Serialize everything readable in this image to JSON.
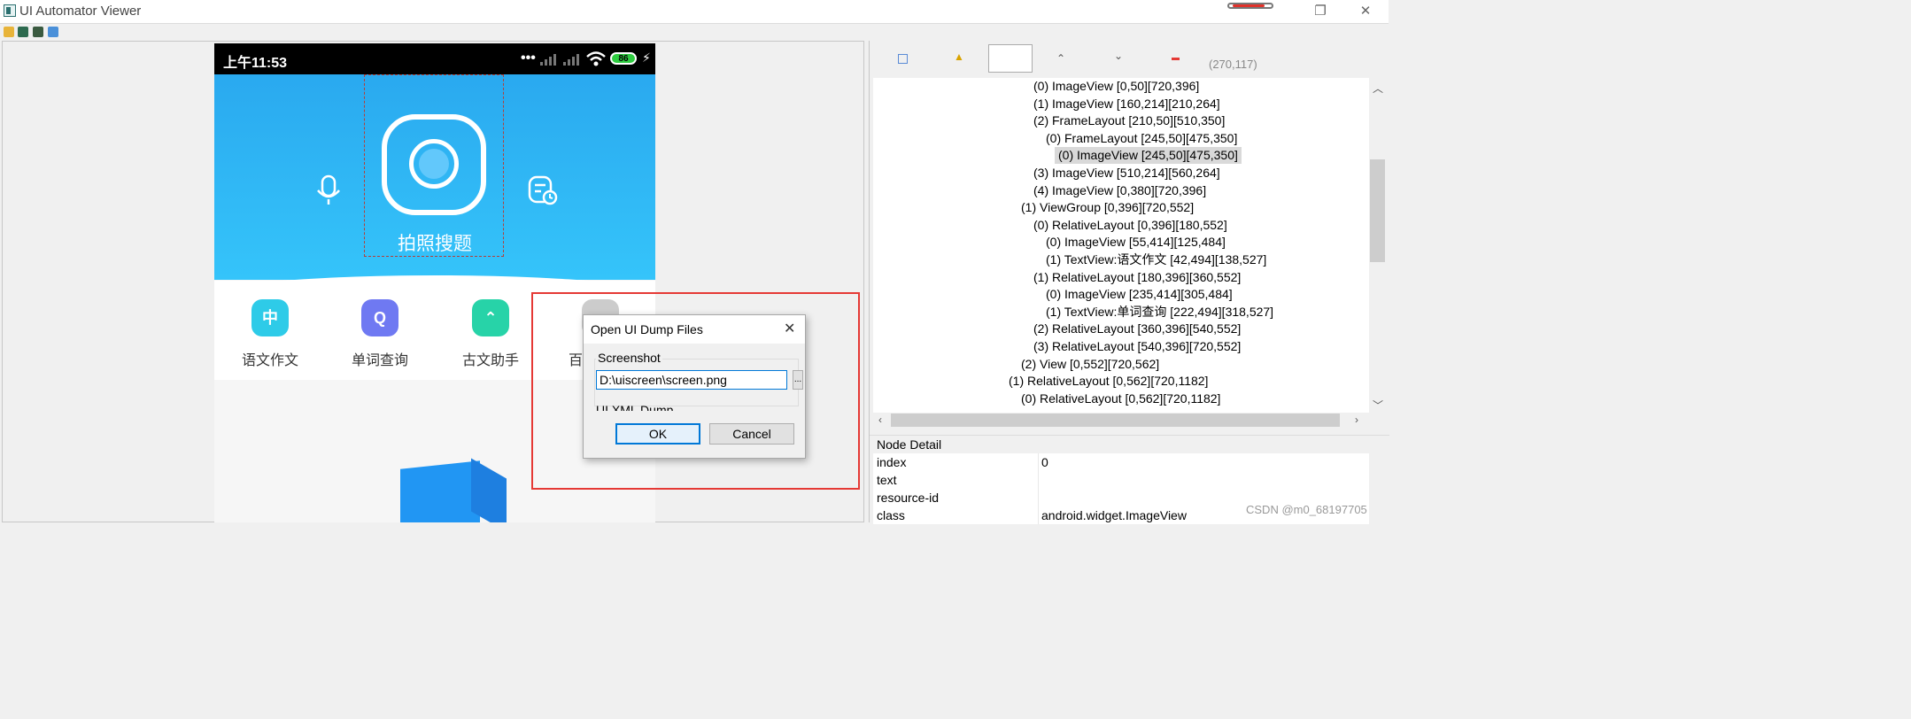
{
  "window": {
    "title": "UI Automator Viewer",
    "restore_glyph": "❐",
    "close_glyph": "✕"
  },
  "phone": {
    "status_time": "上午11:53",
    "status_icons": "••• ",
    "battery": "86",
    "photo_label": "拍照搜题",
    "shortcuts": [
      {
        "label": "语文作文",
        "glyph": "中",
        "color": "#2ecbe8"
      },
      {
        "label": "单词查询",
        "glyph": "Q",
        "color": "#6f79f2"
      },
      {
        "label": "古文助手",
        "glyph": "⌃",
        "color": "#27d3a8"
      },
      {
        "label": "百",
        "glyph": "",
        "color": "#cccccc"
      }
    ]
  },
  "dialog": {
    "title": "Open UI Dump Files",
    "close_glyph": "✕",
    "screenshot_label": "Screenshot",
    "screenshot_path": "D:\\uiscreen\\screen.png",
    "browse_label": "...",
    "xml_label": "UI XML Dump",
    "ok": "OK",
    "cancel": "Cancel"
  },
  "inspector": {
    "coords": "(270,117)",
    "tree": [
      {
        "text": "(0) ImageView [0,50][720,396]",
        "depth": 3
      },
      {
        "text": "(1) ImageView [160,214][210,264]",
        "depth": 3
      },
      {
        "text": "(2) FrameLayout [210,50][510,350]",
        "depth": 3
      },
      {
        "text": "(0) FrameLayout [245,50][475,350]",
        "depth": 4
      },
      {
        "text": "(0) ImageView [245,50][475,350]",
        "depth": 5,
        "selected": true
      },
      {
        "text": "(3) ImageView [510,214][560,264]",
        "depth": 3
      },
      {
        "text": "(4) ImageView [0,380][720,396]",
        "depth": 3
      },
      {
        "text": "(1) ViewGroup [0,396][720,552]",
        "depth": 2
      },
      {
        "text": "(0) RelativeLayout [0,396][180,552]",
        "depth": 3
      },
      {
        "text": "(0) ImageView [55,414][125,484]",
        "depth": 4
      },
      {
        "text": "(1) TextView:语文作文 [42,494][138,527]",
        "depth": 4
      },
      {
        "text": "(1) RelativeLayout [180,396][360,552]",
        "depth": 3
      },
      {
        "text": "(0) ImageView [235,414][305,484]",
        "depth": 4
      },
      {
        "text": "(1) TextView:单词查询 [222,494][318,527]",
        "depth": 4
      },
      {
        "text": "(2) RelativeLayout [360,396][540,552]",
        "depth": 3
      },
      {
        "text": "(3) RelativeLayout [540,396][720,552]",
        "depth": 3
      },
      {
        "text": "(2) View [0,552][720,562]",
        "depth": 2
      },
      {
        "text": "(1) RelativeLayout [0,562][720,1182]",
        "depth": 1
      },
      {
        "text": "(0) RelativeLayout [0,562][720,1182]",
        "depth": 2
      }
    ],
    "node_detail_title": "Node Detail",
    "details": [
      {
        "key": "index",
        "value": "0"
      },
      {
        "key": "text",
        "value": ""
      },
      {
        "key": "resource-id",
        "value": ""
      },
      {
        "key": "class",
        "value": "android.widget.ImageView"
      }
    ]
  },
  "watermark": "CSDN @m0_68197705"
}
